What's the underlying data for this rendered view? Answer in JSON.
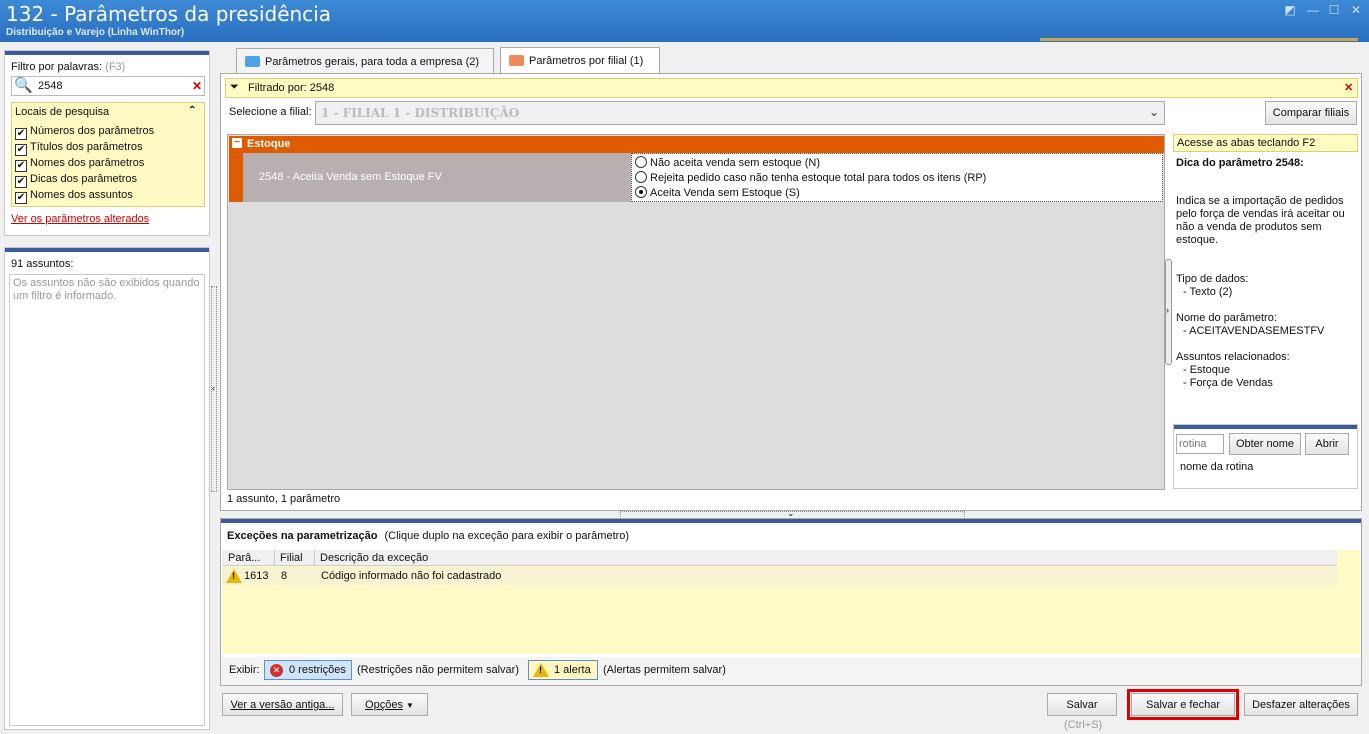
{
  "window": {
    "title": "132 - Parâmetros da presidência",
    "subtitle": "Distribuição e Varejo (Linha WinThor)",
    "min_glyph": "—",
    "max_glyph": "☐",
    "close_glyph": "✕"
  },
  "filter": {
    "label": "Filtro por palavras:",
    "shortcut": "(F3)",
    "search_value": "2548",
    "locais_label": "Locais de pesquisa",
    "locais": [
      {
        "label": "Números dos parâmetros",
        "checked": true
      },
      {
        "label": "Títulos dos parâmetros",
        "checked": true
      },
      {
        "label": "Nomes dos parâmetros",
        "checked": true
      },
      {
        "label": "Dicas dos parâmetros",
        "checked": true
      },
      {
        "label": "Nomes dos assuntos",
        "checked": true
      }
    ],
    "altered_link": "Ver os parâmetros alterados"
  },
  "assuntos": {
    "count_label": "91 assuntos:",
    "note": "Os assuntos não são exibidos quando um filtro é informado."
  },
  "tabs": [
    {
      "label": "Parâmetros gerais, para toda a empresa",
      "count": "(2)",
      "active": false
    },
    {
      "label": "Parâmetros por filial",
      "count": "(1)",
      "active": true
    }
  ],
  "main": {
    "filtered_by": "Filtrado por: 2548",
    "filial_label": "Selecione a filial:",
    "filial_value": "1 - FILIAL 1 - DISTRIBUIÇÃO",
    "compare_button": "Comparar filiais",
    "group": "Estoque",
    "group_toggle": "−",
    "param_name": "2548 - Aceita Venda sem Estoque FV",
    "options": [
      {
        "label": "Não aceita venda sem estoque (N)",
        "selected": false
      },
      {
        "label": "Rejeita pedido caso não tenha estoque total para todos os itens (RP)",
        "selected": false
      },
      {
        "label": "Aceita Venda sem Estoque (S)",
        "selected": true
      }
    ],
    "summary": "1 assunto, 1 parâmetro"
  },
  "dica": {
    "access_hint": "Acesse as abas teclando F2",
    "title": "Dica do parâmetro 2548:",
    "description": "Indica se a importação de pedidos pelo força de vendas irá aceitar ou não a venda de produtos sem estoque.",
    "tipo_label": "Tipo de dados:",
    "tipo_value": "- Texto (2)",
    "nome_label": "Nome do parâmetro:",
    "nome_value": "- ACEITAVENDASEMESTFV",
    "assuntos_label": "Assuntos relacionados:",
    "assuntos": [
      "- Estoque",
      "- Força de Vendas"
    ],
    "rotina_placeholder": "rotina",
    "obter_nome": "Obter nome",
    "abrir": "Abrir",
    "nome_rotina": "nome da rotina"
  },
  "excecoes": {
    "title": "Exceções na parametrização",
    "hint": "(Clique duplo na exceção para exibir o parâmetro)",
    "columns": [
      "Parâ...",
      "Filial",
      "Descrição da exceção"
    ],
    "rows": [
      {
        "param": "1613",
        "filial": "8",
        "descricao": "Código informado não foi cadastrado"
      }
    ],
    "exibir_label": "Exibir:",
    "restricoes_button": "0 restrições",
    "restricoes_note": "(Restrições não permitem salvar)",
    "alertas_button": "1 alerta",
    "alertas_note": "(Alertas permitem salvar)"
  },
  "footer": {
    "versao_antiga": "Ver a versão antiga...",
    "opcoes": "Opções",
    "salvar": "Salvar",
    "salvar_shortcut": "(Ctrl+S)",
    "salvar_fechar": "Salvar e fechar",
    "desfazer": "Desfazer alterações"
  },
  "colors": {
    "title_bar": "#2a6fbf",
    "group_header": "#e05a00",
    "highlight_border": "#e00000"
  }
}
